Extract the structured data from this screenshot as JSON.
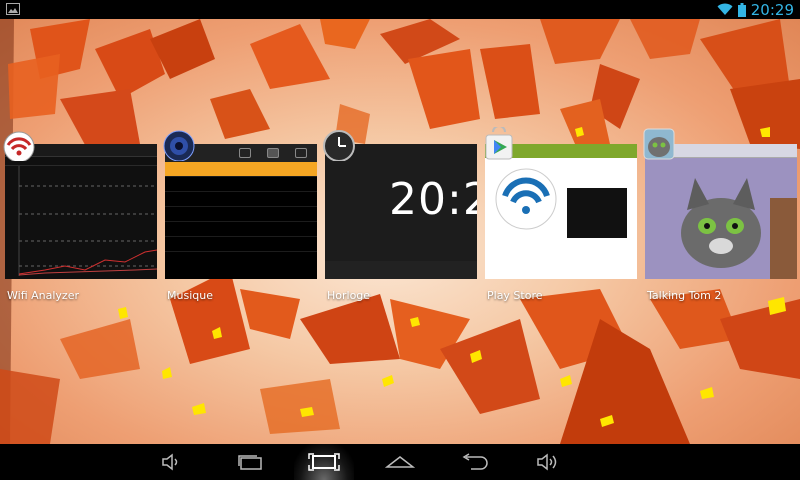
{
  "status_bar": {
    "time": "20:29",
    "icons": [
      "notification-image-icon",
      "wifi-icon",
      "battery-icon"
    ]
  },
  "recent_apps": [
    {
      "label": "Wifi Analyzer",
      "icon": "wifi-analyzer-icon"
    },
    {
      "label": "Musique",
      "icon": "music-speaker-icon"
    },
    {
      "label": "Horloge",
      "icon": "clock-icon"
    },
    {
      "label": "Play Store",
      "icon": "play-store-icon"
    },
    {
      "label": "Talking Tom 2",
      "icon": "talking-tom-icon"
    }
  ],
  "thumbnails": {
    "clock_time": "20:2"
  },
  "nav_bar": {
    "buttons": [
      "volume-down-icon",
      "screenshot-icon",
      "recent-apps-icon",
      "home-icon",
      "back-icon",
      "volume-up-icon"
    ]
  },
  "colors": {
    "status_accent": "#33b5e5",
    "wallpaper_base": "#f5c8a4",
    "shard_orange": "#e0541a",
    "shard_yellow": "#ffe600"
  }
}
